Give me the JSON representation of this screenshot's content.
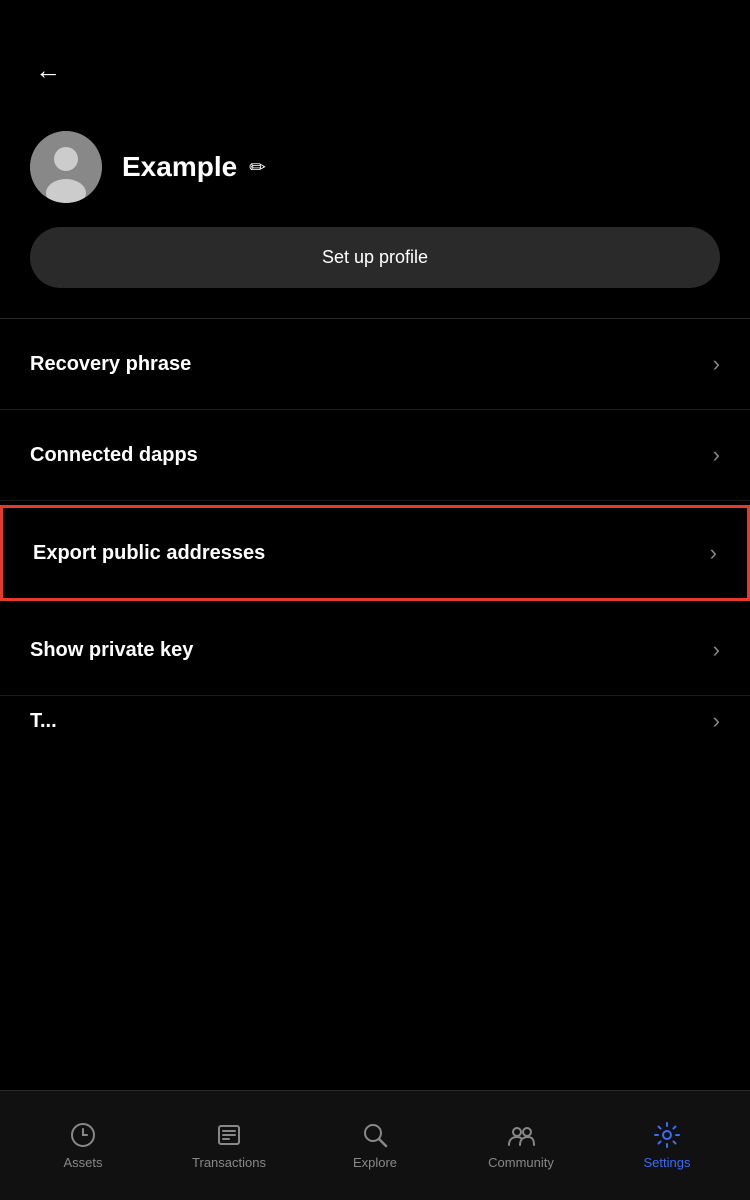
{
  "header": {
    "back_label": "←"
  },
  "profile": {
    "name": "Example",
    "edit_icon_label": "✏",
    "setup_button_label": "Set up profile"
  },
  "menu": {
    "items": [
      {
        "id": "recovery-phrase",
        "label": "Recovery phrase",
        "highlighted": false
      },
      {
        "id": "connected-dapps",
        "label": "Connected dapps",
        "highlighted": false
      },
      {
        "id": "export-public-addresses",
        "label": "Export public addresses",
        "highlighted": true
      },
      {
        "id": "show-private-key",
        "label": "Show private key",
        "highlighted": false
      },
      {
        "id": "partial-item",
        "label": "T...",
        "highlighted": false,
        "partial": true
      }
    ]
  },
  "bottom_nav": {
    "items": [
      {
        "id": "assets",
        "label": "Assets",
        "active": false,
        "icon": "chart"
      },
      {
        "id": "transactions",
        "label": "Transactions",
        "active": false,
        "icon": "list"
      },
      {
        "id": "explore",
        "label": "Explore",
        "active": false,
        "icon": "search"
      },
      {
        "id": "community",
        "label": "Community",
        "active": false,
        "icon": "community"
      },
      {
        "id": "settings",
        "label": "Settings",
        "active": true,
        "icon": "gear"
      }
    ]
  },
  "colors": {
    "active_nav": "#3b6cf7",
    "highlight_border": "#e63a2e",
    "background": "#000000",
    "surface": "#2a2a2a"
  }
}
